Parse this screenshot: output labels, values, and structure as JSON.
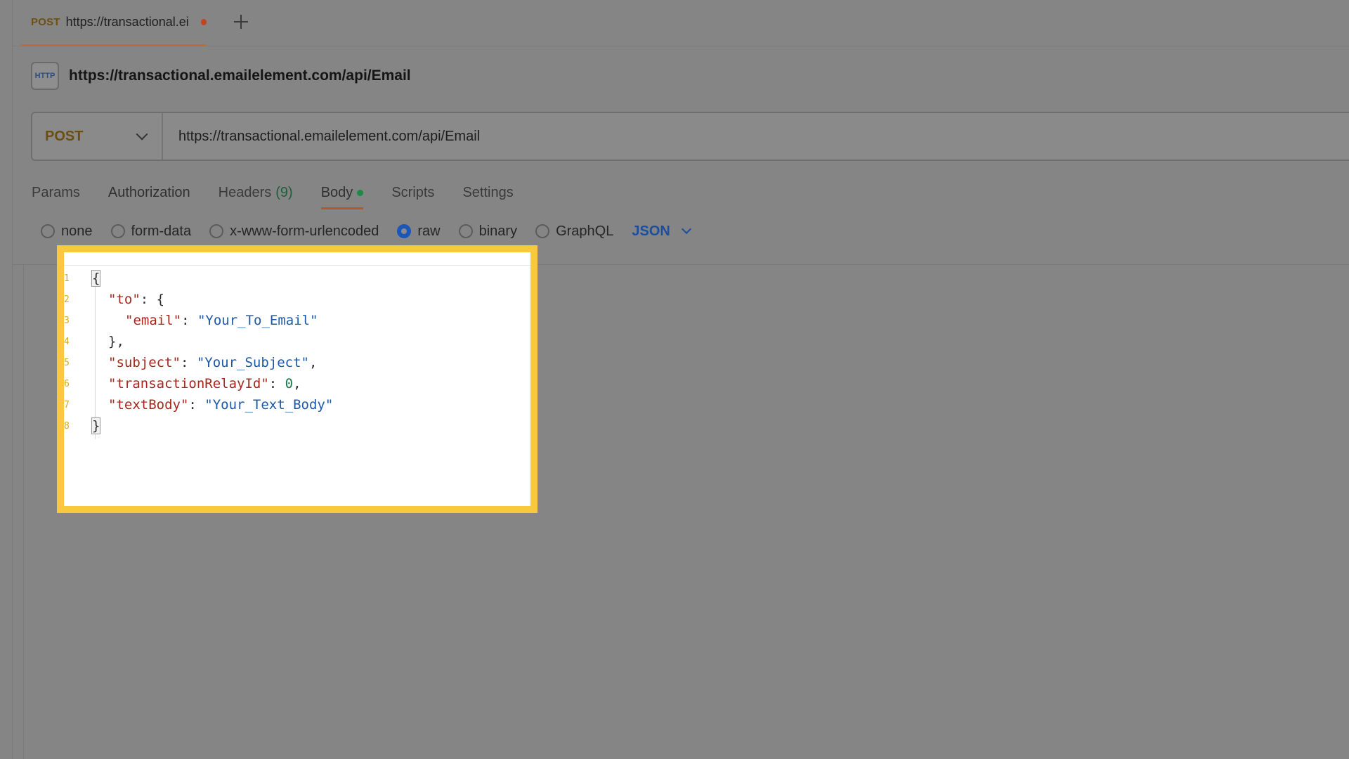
{
  "tabbar": {
    "tab": {
      "method": "POST",
      "url": "https://transactional.ei"
    }
  },
  "request": {
    "title": "https://transactional.emailelement.com/api/Email",
    "http_icon_text": "HTTP",
    "method": "POST",
    "url": "https://transactional.emailelement.com/api/Email"
  },
  "tabs": {
    "params": "Params",
    "authorization": "Authorization",
    "headers": "Headers",
    "headers_count": "(9)",
    "body": "Body",
    "scripts": "Scripts",
    "settings": "Settings"
  },
  "body_types": {
    "none": "none",
    "form_data": "form-data",
    "urlencoded": "x-www-form-urlencoded",
    "raw": "raw",
    "binary": "binary",
    "graphql": "GraphQL",
    "selected_format": "JSON"
  },
  "editor": {
    "lines": [
      {
        "num": "1",
        "text": "{"
      },
      {
        "num": "2",
        "key": "\"to\"",
        "rest": ": {"
      },
      {
        "num": "3",
        "key": "\"email\"",
        "sep": ": ",
        "value": "\"Your_To_Email\""
      },
      {
        "num": "4",
        "text": "},"
      },
      {
        "num": "5",
        "key": "\"subject\"",
        "sep": ": ",
        "value": "\"Your_Subject\"",
        "tail": ","
      },
      {
        "num": "6",
        "key": "\"transactionRelayId\"",
        "sep": ": ",
        "num_value": "0",
        "tail": ","
      },
      {
        "num": "7",
        "key": "\"textBody\"",
        "sep": ": ",
        "value": "\"Your_Text_Body\""
      },
      {
        "num": "8",
        "text": "}"
      }
    ]
  },
  "colors": {
    "highlight_border": "#f8c93d",
    "json_key": "#a5281e",
    "json_string": "#1e58a6",
    "json_number": "#1a7a4a",
    "active_tab_underline": "#b2592a"
  }
}
